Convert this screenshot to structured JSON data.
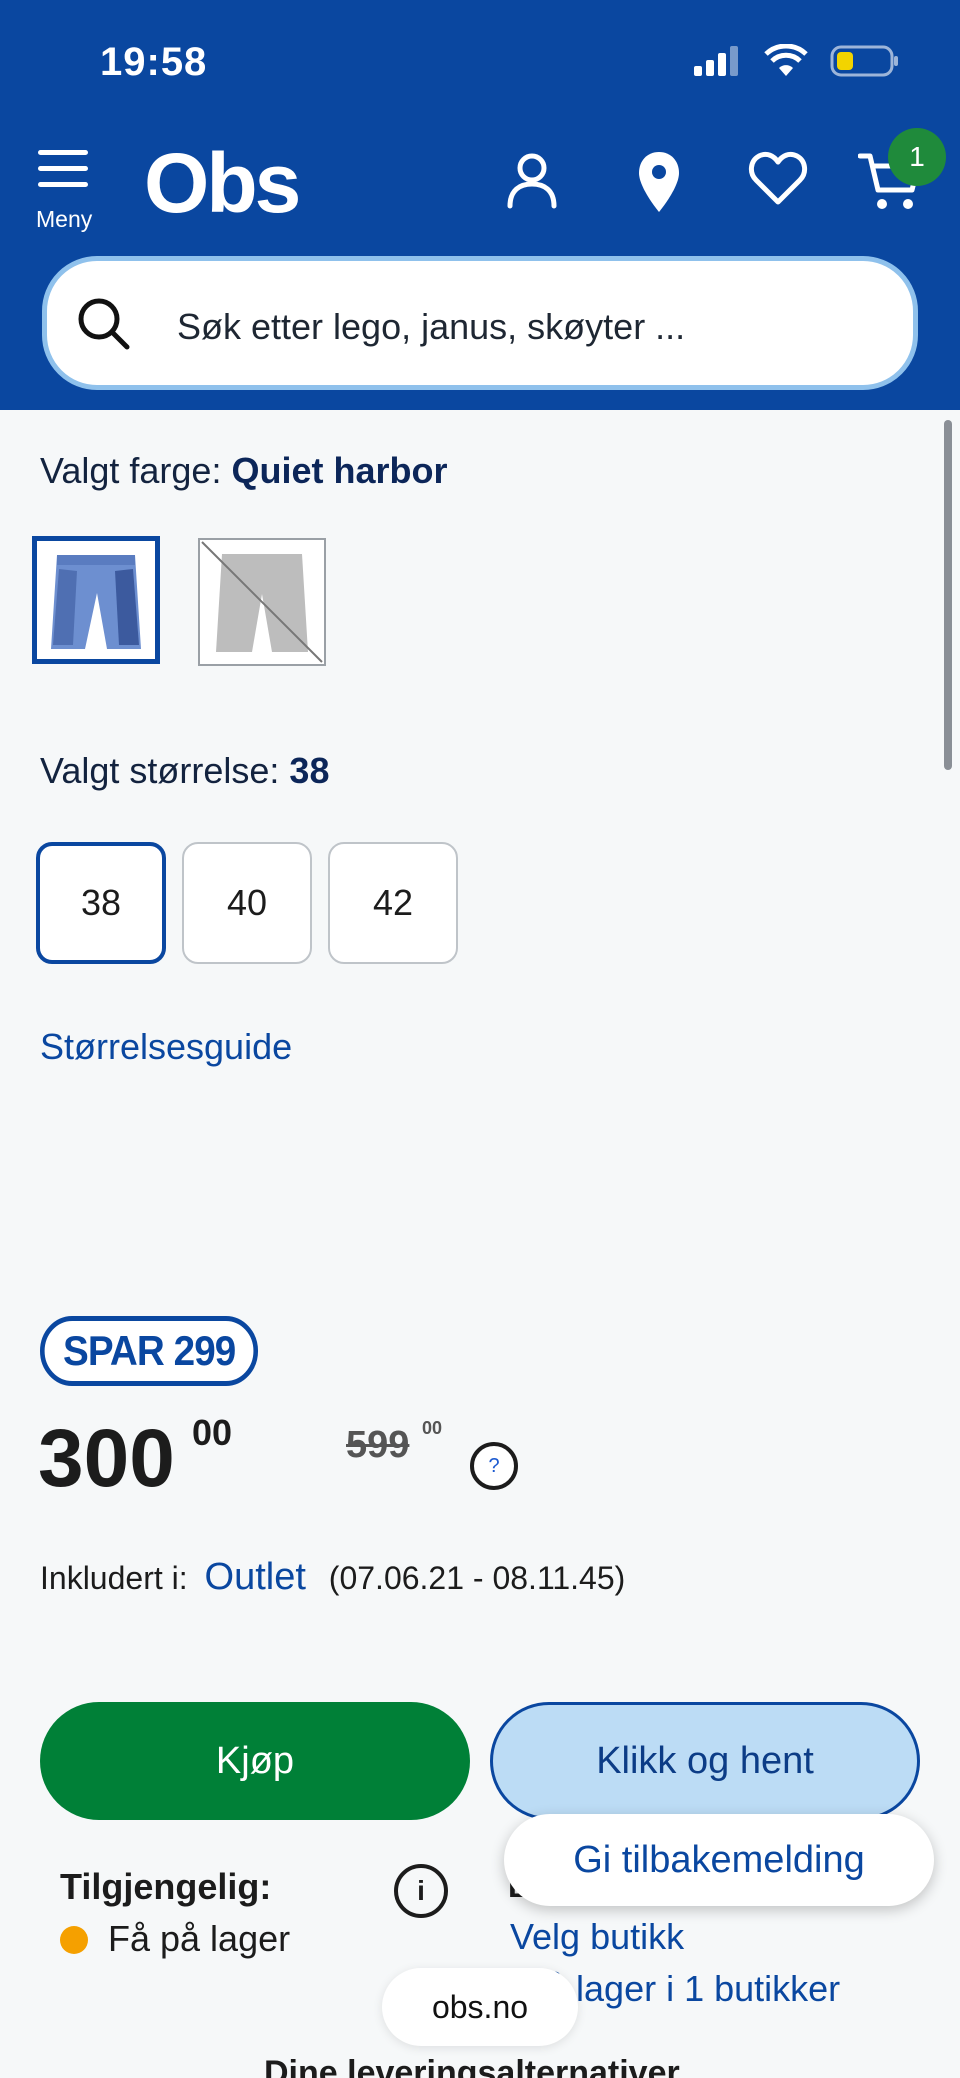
{
  "status": {
    "time": "19:58"
  },
  "header": {
    "menu_label": "Meny",
    "logo": "Obs",
    "cart_count": "1",
    "icons": [
      "menu-icon",
      "user-icon",
      "location-pin-icon",
      "heart-icon",
      "cart-icon"
    ]
  },
  "search": {
    "placeholder": "Søk etter lego, janus, skøyter ..."
  },
  "product": {
    "color_label": "Valgt farge:",
    "color_value": "Quiet harbor",
    "size_label": "Valgt størrelse:",
    "size_value": "38",
    "sizes": [
      "38",
      "40",
      "42"
    ],
    "size_guide": "Størrelsesguide"
  },
  "price": {
    "badge": "SPAR 299",
    "main": "300",
    "main_dec": "00",
    "old": "599",
    "old_dec": "00",
    "help": "?"
  },
  "campaign": {
    "label": "Inkludert i:",
    "name": "Outlet",
    "period": "(07.06.21 - 08.11.45)"
  },
  "actions": {
    "buy": "Kjøp",
    "click_collect": "Klikk og hent",
    "feedback": "Gi tilbakemelding"
  },
  "availability": {
    "title": "Tilgjengelig:",
    "status": "Få på lager",
    "status_color": "#f5a000",
    "info": "i",
    "store_heading_partial": "B",
    "select_store": "Velg butikk",
    "store_stock": "å lager i 1 butikker"
  },
  "browser": {
    "url": "obs.no"
  },
  "delivery": {
    "heading_partial": "Dine leveringsalternativer"
  },
  "colors": {
    "brand": "#0a47a0",
    "buy": "#008037",
    "badge": "#1f8a3b"
  }
}
